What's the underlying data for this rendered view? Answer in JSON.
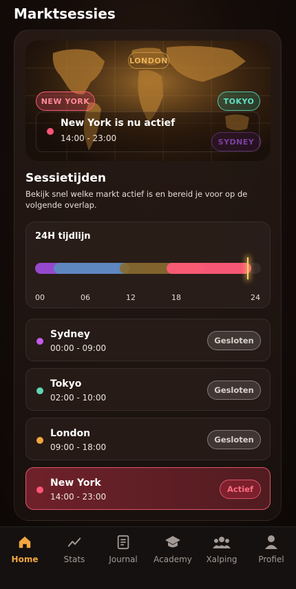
{
  "page": {
    "title": "Marktsessies"
  },
  "map": {
    "labels": {
      "new_york": "NEW YORK",
      "london": "LONDON",
      "tokyo": "TOKYO",
      "sydney": "SYDNEY"
    },
    "active_title": "New York is nu actief",
    "active_time": "14:00 - 23:00"
  },
  "sessions_section": {
    "title": "Sessietijden",
    "description": "Bekijk snel welke markt actief is en bereid je voor op de volgende overlap."
  },
  "timeline": {
    "title": "24H tijdlijn",
    "ticks": [
      "00",
      "06",
      "12",
      "18",
      "24"
    ],
    "now_hour": 22.5,
    "segments": [
      {
        "session": "Sydney",
        "start": 0,
        "end": 9,
        "color": "#9b4ad6"
      },
      {
        "session": "Tokyo",
        "start": 2,
        "end": 10,
        "color": "#5b8bbf"
      },
      {
        "session": "London",
        "start": 9,
        "end": 18,
        "color": "#8a6a2e"
      },
      {
        "session": "New York",
        "start": 14,
        "end": 23,
        "color": "#ff5a78"
      }
    ]
  },
  "sessions": [
    {
      "name": "Sydney",
      "time": "00:00 - 09:00",
      "status": "Gesloten",
      "color": "#c45be8"
    },
    {
      "name": "Tokyo",
      "time": "02:00 - 10:00",
      "status": "Gesloten",
      "color": "#5fd6b4"
    },
    {
      "name": "London",
      "time": "09:00 - 18:00",
      "status": "Gesloten",
      "color": "#f0a640"
    },
    {
      "name": "New York",
      "time": "14:00 - 23:00",
      "status": "Actief",
      "color": "#ff5577"
    }
  ],
  "nav": {
    "items": [
      {
        "label": "Home",
        "icon": "home-icon"
      },
      {
        "label": "Stats",
        "icon": "chart-icon"
      },
      {
        "label": "Journal",
        "icon": "journal-icon"
      },
      {
        "label": "Academy",
        "icon": "graduation-cap-icon"
      },
      {
        "label": "Xalping",
        "icon": "people-icon"
      },
      {
        "label": "Profiel",
        "icon": "user-icon"
      }
    ],
    "active": "Home"
  },
  "colors": {
    "accent": "#f0a640",
    "active_red": "#ff5577"
  }
}
